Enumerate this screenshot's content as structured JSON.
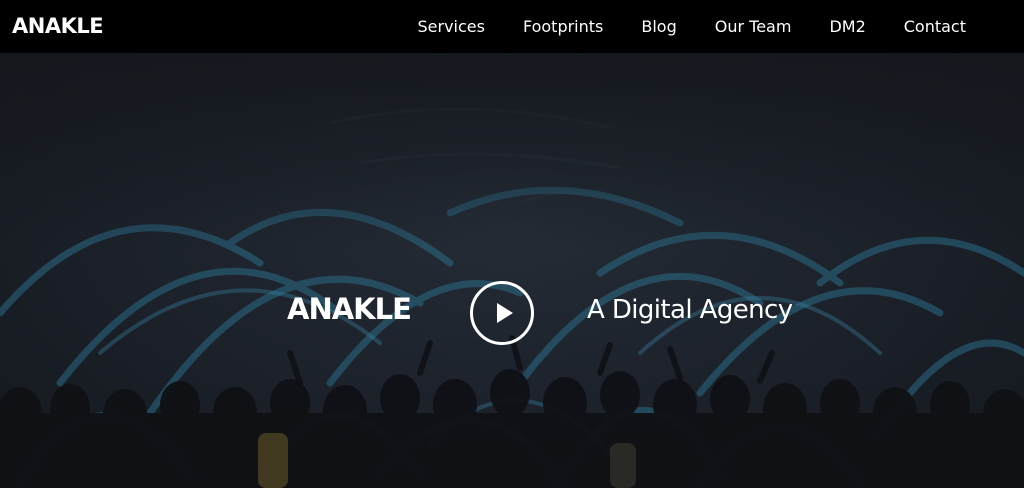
{
  "brand": {
    "name": "ANAKLE"
  },
  "nav": {
    "items": [
      {
        "label": "Services"
      },
      {
        "label": "Footprints"
      },
      {
        "label": "Blog"
      },
      {
        "label": "Our Team"
      },
      {
        "label": "DM2"
      },
      {
        "label": "Contact"
      }
    ]
  },
  "hero": {
    "logo": "ANAKLE",
    "play_icon": "play-icon",
    "tagline": "A Digital Agency"
  },
  "colors": {
    "navbar_bg": "#000000",
    "hero_bg": "#1b2029",
    "hero_overlay_accent": "#2a6b86",
    "text": "#ffffff"
  }
}
